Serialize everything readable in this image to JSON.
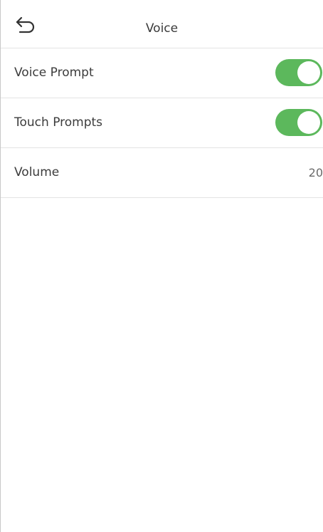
{
  "header": {
    "title": "Voice",
    "back_icon": "back-arrow-icon"
  },
  "settings": [
    {
      "label": "Voice Prompt",
      "type": "toggle",
      "enabled": true
    },
    {
      "label": "Touch Prompts",
      "type": "toggle",
      "enabled": true
    },
    {
      "label": "Volume",
      "type": "value",
      "value": "20"
    }
  ],
  "colors": {
    "toggle_on": "#5cb85c",
    "divider": "#e3e3e3",
    "text": "#3c3c3c",
    "value_text": "#6a6a6a"
  }
}
